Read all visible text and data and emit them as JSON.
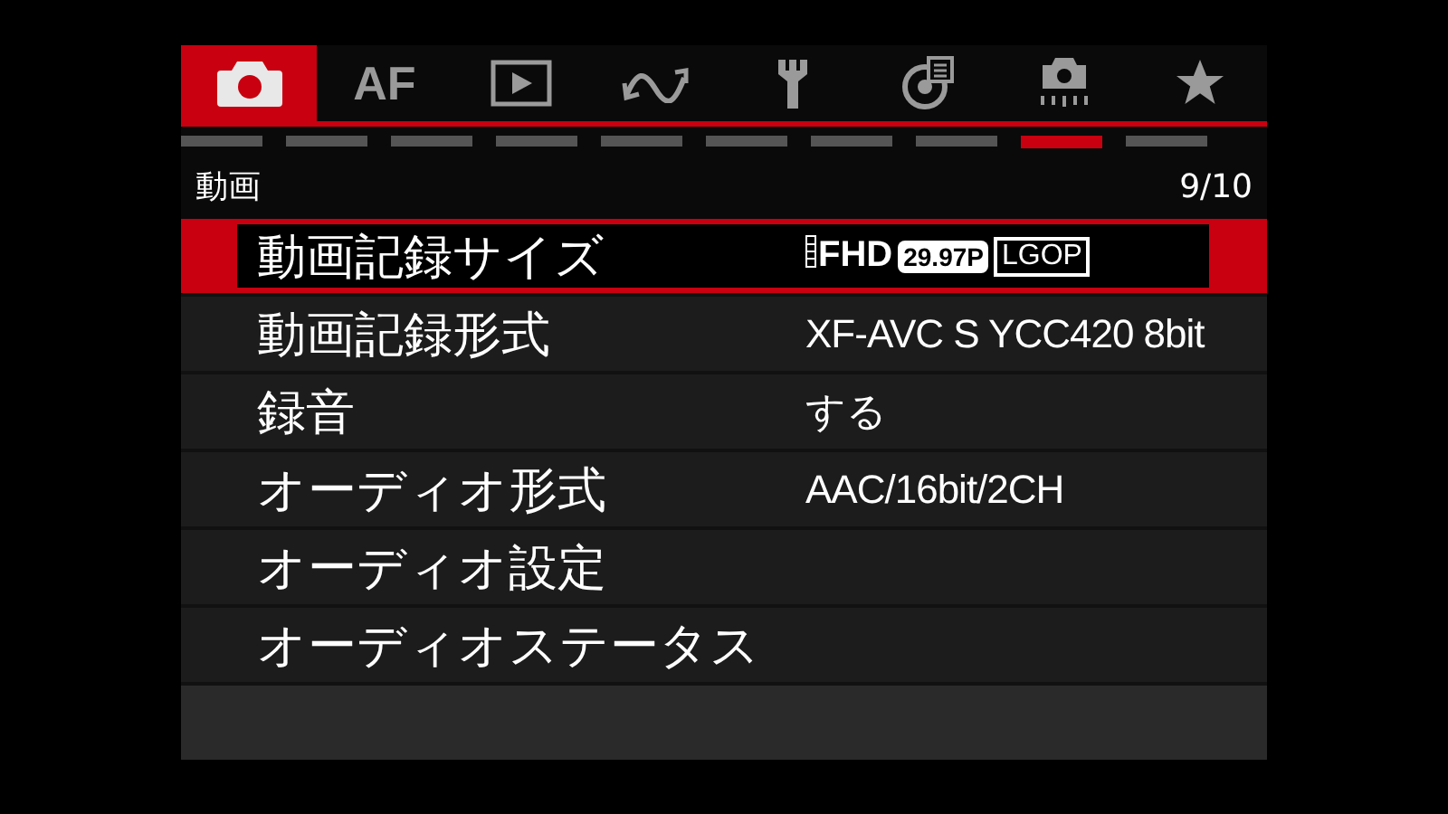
{
  "tabs": [
    {
      "selected": true
    },
    {
      "label": "AF",
      "selected": false
    },
    {
      "selected": false
    },
    {
      "selected": false
    },
    {
      "selected": false
    },
    {
      "selected": false
    },
    {
      "selected": false
    },
    {
      "selected": false
    }
  ],
  "pages": [
    {
      "selected": false
    },
    {
      "selected": false
    },
    {
      "selected": false
    },
    {
      "selected": false
    },
    {
      "selected": false
    },
    {
      "selected": false
    },
    {
      "selected": false
    },
    {
      "selected": false
    },
    {
      "selected": true
    },
    {
      "selected": false
    }
  ],
  "header": {
    "title": "動画",
    "page": "9/10"
  },
  "rows": [
    {
      "label": "動画記録サイズ",
      "selected": true,
      "value_parts": [
        {
          "kind": "film",
          "text": "FHD"
        },
        {
          "kind": "filled",
          "text": "29.97P"
        },
        {
          "kind": "outlined",
          "text": "LGOP"
        }
      ]
    },
    {
      "label": "動画記録形式",
      "selected": false,
      "value": "XF-AVC S YCC420 8bit"
    },
    {
      "label": "録音",
      "selected": false,
      "value": "する"
    },
    {
      "label": "オーディオ形式",
      "selected": false,
      "value": "AAC/16bit/2CH"
    },
    {
      "label": "オーディオ設定",
      "selected": false
    },
    {
      "label": "オーディオステータス",
      "selected": false
    }
  ]
}
